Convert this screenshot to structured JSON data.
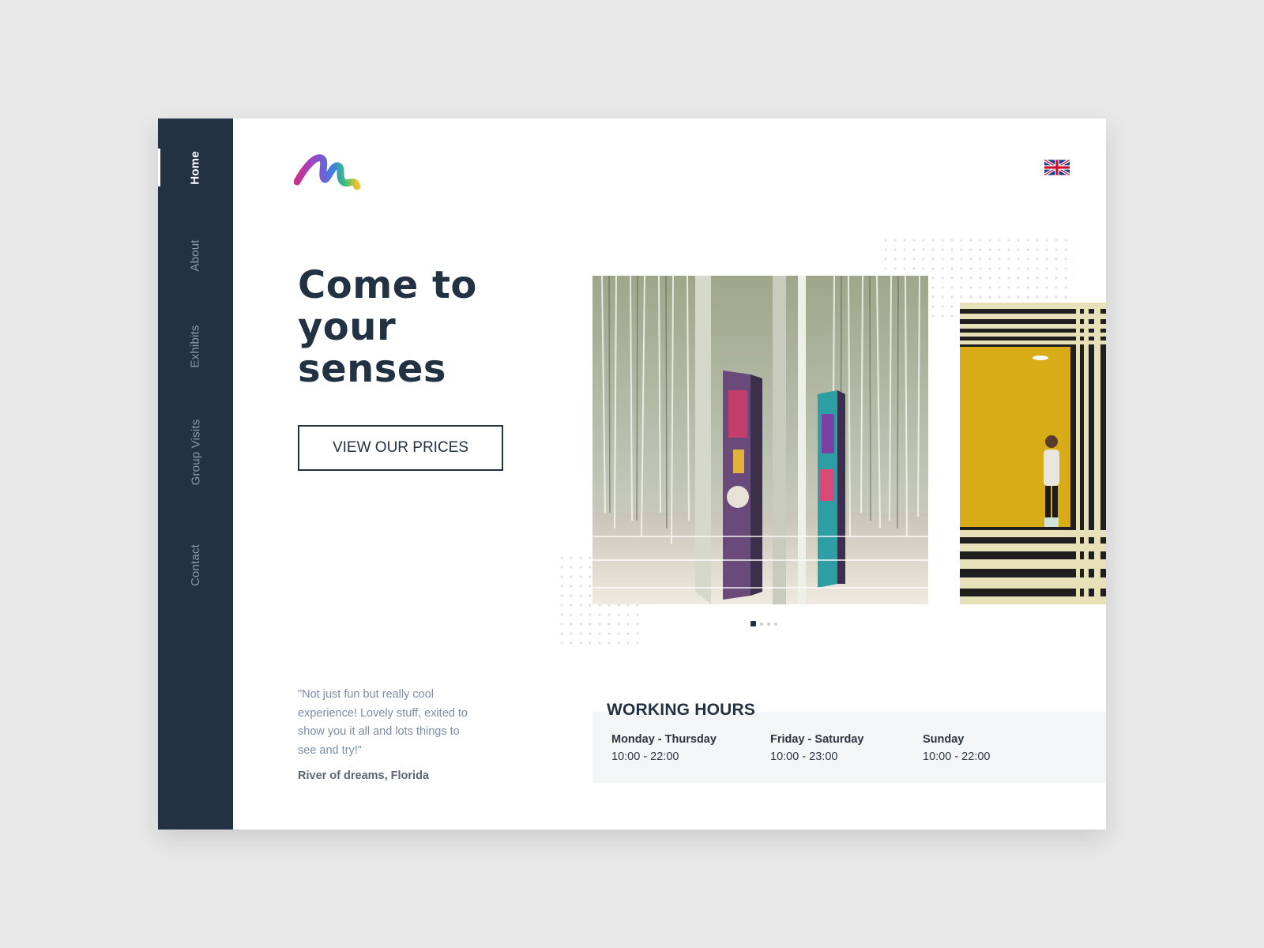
{
  "sidebar": {
    "items": [
      {
        "label": "Home",
        "active": true
      },
      {
        "label": "About",
        "active": false
      },
      {
        "label": "Exhibits",
        "active": false
      },
      {
        "label": "Group Visits",
        "active": false
      },
      {
        "label": "Contact",
        "active": false
      }
    ]
  },
  "header": {
    "logo_icon": "brush-stroke-m-logo",
    "language_icon": "uk-flag-icon"
  },
  "hero": {
    "title": "Come to your senses",
    "cta_label": "VIEW OUR PRICES"
  },
  "carousel": {
    "slide_count": 4,
    "active_index": 0
  },
  "testimonial": {
    "quote": "\"Not just fun but really cool experience! Lovely stuff, exited to show you it all and lots things to see and try!\"",
    "author": "River of dreams, Florida"
  },
  "working_hours": {
    "title": "WORKING HOURS",
    "entries": [
      {
        "days": "Monday - Thursday",
        "time": "10:00 - 22:00"
      },
      {
        "days": "Friday - Saturday",
        "time": "10:00 - 23:00"
      },
      {
        "days": "Sunday",
        "time": "10:00 - 22:00"
      }
    ]
  },
  "colors": {
    "sidebar": "#233243",
    "text_dark": "#233243",
    "quote_text": "#7b8ea5",
    "hours_panel": "#f4f5f6"
  }
}
